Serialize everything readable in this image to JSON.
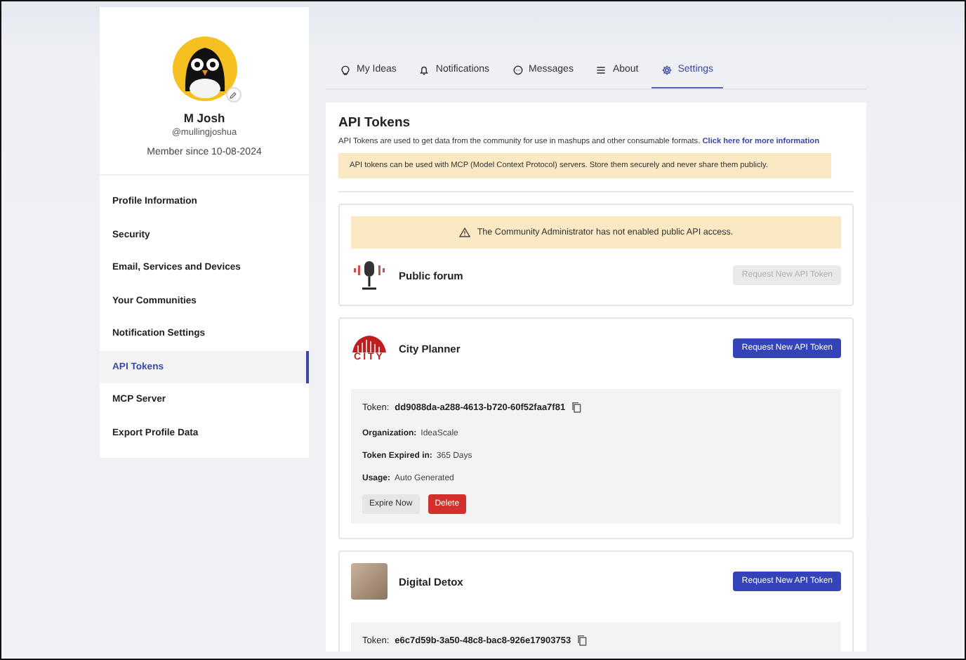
{
  "profile": {
    "name": "M Josh",
    "handle": "@mullingjoshua",
    "member_since": "Member since 10-08-2024"
  },
  "sidebar": {
    "items": [
      {
        "label": "Profile Information",
        "selected": false
      },
      {
        "label": "Security",
        "selected": false
      },
      {
        "label": "Email, Services and Devices",
        "selected": false
      },
      {
        "label": "Your Communities",
        "selected": false
      },
      {
        "label": "Notification Settings",
        "selected": false
      },
      {
        "label": "API Tokens",
        "selected": true
      },
      {
        "label": "MCP Server",
        "selected": false
      },
      {
        "label": "Export Profile Data",
        "selected": false
      }
    ]
  },
  "tabs": [
    {
      "label": "My Ideas",
      "selected": false
    },
    {
      "label": "Notifications",
      "selected": false
    },
    {
      "label": "Messages",
      "selected": false
    },
    {
      "label": "About",
      "selected": false
    },
    {
      "label": "Settings",
      "selected": true
    }
  ],
  "api_tokens": {
    "title": "API Tokens",
    "description": "API Tokens are used to get data from the community for use in mashups and other consumable formats.",
    "link": "Click here for more information",
    "notice": "API tokens can be used with MCP (Model Context Protocol) servers. Store them securely and never share them publicly."
  },
  "communities": [
    {
      "name": "Public forum",
      "warning": "The Community Administrator has not enabled public API access.",
      "request_button": {
        "label": "Request New API Token",
        "disabled": true
      }
    },
    {
      "name": "City Planner",
      "logo_text": "CITY",
      "request_button": {
        "label": "Request New API Token",
        "disabled": false
      },
      "token": {
        "label": "Token:",
        "value": "dd9088da-a288-4613-b720-60f52faa7f81",
        "fields": [
          {
            "label": "Organization:",
            "value": "IdeaScale"
          },
          {
            "label": "Token Expired in:",
            "value": "365 Days"
          },
          {
            "label": "Usage:",
            "value": "Auto Generated"
          }
        ],
        "buttons": [
          {
            "label": "Expire Now",
            "kind": "secondary"
          },
          {
            "label": "Delete",
            "kind": "danger"
          }
        ]
      }
    },
    {
      "name": "Digital Detox",
      "request_button": {
        "label": "Request New API Token",
        "disabled": false
      },
      "token": {
        "label": "Token:",
        "value": "e6c7d59b-3a50-48c8-bac8-926e17903753"
      }
    }
  ]
}
